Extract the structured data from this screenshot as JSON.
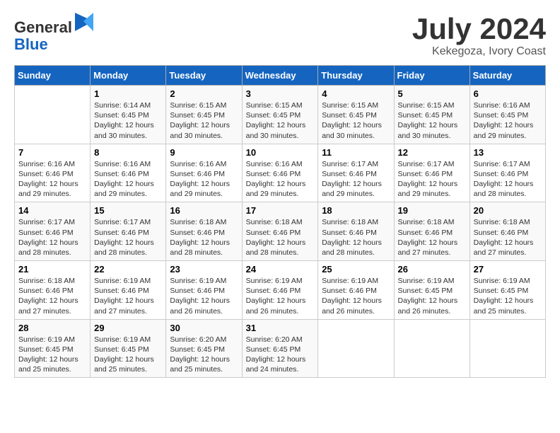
{
  "header": {
    "logo_line1": "General",
    "logo_line2": "Blue",
    "month": "July 2024",
    "location": "Kekegoza, Ivory Coast"
  },
  "days_of_week": [
    "Sunday",
    "Monday",
    "Tuesday",
    "Wednesday",
    "Thursday",
    "Friday",
    "Saturday"
  ],
  "weeks": [
    [
      {
        "day": "",
        "content": ""
      },
      {
        "day": "1",
        "content": "Sunrise: 6:14 AM\nSunset: 6:45 PM\nDaylight: 12 hours\nand 30 minutes."
      },
      {
        "day": "2",
        "content": "Sunrise: 6:15 AM\nSunset: 6:45 PM\nDaylight: 12 hours\nand 30 minutes."
      },
      {
        "day": "3",
        "content": "Sunrise: 6:15 AM\nSunset: 6:45 PM\nDaylight: 12 hours\nand 30 minutes."
      },
      {
        "day": "4",
        "content": "Sunrise: 6:15 AM\nSunset: 6:45 PM\nDaylight: 12 hours\nand 30 minutes."
      },
      {
        "day": "5",
        "content": "Sunrise: 6:15 AM\nSunset: 6:45 PM\nDaylight: 12 hours\nand 30 minutes."
      },
      {
        "day": "6",
        "content": "Sunrise: 6:16 AM\nSunset: 6:45 PM\nDaylight: 12 hours\nand 29 minutes."
      }
    ],
    [
      {
        "day": "7",
        "content": "Sunrise: 6:16 AM\nSunset: 6:46 PM\nDaylight: 12 hours\nand 29 minutes."
      },
      {
        "day": "8",
        "content": "Sunrise: 6:16 AM\nSunset: 6:46 PM\nDaylight: 12 hours\nand 29 minutes."
      },
      {
        "day": "9",
        "content": "Sunrise: 6:16 AM\nSunset: 6:46 PM\nDaylight: 12 hours\nand 29 minutes."
      },
      {
        "day": "10",
        "content": "Sunrise: 6:16 AM\nSunset: 6:46 PM\nDaylight: 12 hours\nand 29 minutes."
      },
      {
        "day": "11",
        "content": "Sunrise: 6:17 AM\nSunset: 6:46 PM\nDaylight: 12 hours\nand 29 minutes."
      },
      {
        "day": "12",
        "content": "Sunrise: 6:17 AM\nSunset: 6:46 PM\nDaylight: 12 hours\nand 29 minutes."
      },
      {
        "day": "13",
        "content": "Sunrise: 6:17 AM\nSunset: 6:46 PM\nDaylight: 12 hours\nand 28 minutes."
      }
    ],
    [
      {
        "day": "14",
        "content": "Sunrise: 6:17 AM\nSunset: 6:46 PM\nDaylight: 12 hours\nand 28 minutes."
      },
      {
        "day": "15",
        "content": "Sunrise: 6:17 AM\nSunset: 6:46 PM\nDaylight: 12 hours\nand 28 minutes."
      },
      {
        "day": "16",
        "content": "Sunrise: 6:18 AM\nSunset: 6:46 PM\nDaylight: 12 hours\nand 28 minutes."
      },
      {
        "day": "17",
        "content": "Sunrise: 6:18 AM\nSunset: 6:46 PM\nDaylight: 12 hours\nand 28 minutes."
      },
      {
        "day": "18",
        "content": "Sunrise: 6:18 AM\nSunset: 6:46 PM\nDaylight: 12 hours\nand 28 minutes."
      },
      {
        "day": "19",
        "content": "Sunrise: 6:18 AM\nSunset: 6:46 PM\nDaylight: 12 hours\nand 27 minutes."
      },
      {
        "day": "20",
        "content": "Sunrise: 6:18 AM\nSunset: 6:46 PM\nDaylight: 12 hours\nand 27 minutes."
      }
    ],
    [
      {
        "day": "21",
        "content": "Sunrise: 6:18 AM\nSunset: 6:46 PM\nDaylight: 12 hours\nand 27 minutes."
      },
      {
        "day": "22",
        "content": "Sunrise: 6:19 AM\nSunset: 6:46 PM\nDaylight: 12 hours\nand 27 minutes."
      },
      {
        "day": "23",
        "content": "Sunrise: 6:19 AM\nSunset: 6:46 PM\nDaylight: 12 hours\nand 26 minutes."
      },
      {
        "day": "24",
        "content": "Sunrise: 6:19 AM\nSunset: 6:46 PM\nDaylight: 12 hours\nand 26 minutes."
      },
      {
        "day": "25",
        "content": "Sunrise: 6:19 AM\nSunset: 6:46 PM\nDaylight: 12 hours\nand 26 minutes."
      },
      {
        "day": "26",
        "content": "Sunrise: 6:19 AM\nSunset: 6:45 PM\nDaylight: 12 hours\nand 26 minutes."
      },
      {
        "day": "27",
        "content": "Sunrise: 6:19 AM\nSunset: 6:45 PM\nDaylight: 12 hours\nand 25 minutes."
      }
    ],
    [
      {
        "day": "28",
        "content": "Sunrise: 6:19 AM\nSunset: 6:45 PM\nDaylight: 12 hours\nand 25 minutes."
      },
      {
        "day": "29",
        "content": "Sunrise: 6:19 AM\nSunset: 6:45 PM\nDaylight: 12 hours\nand 25 minutes."
      },
      {
        "day": "30",
        "content": "Sunrise: 6:20 AM\nSunset: 6:45 PM\nDaylight: 12 hours\nand 25 minutes."
      },
      {
        "day": "31",
        "content": "Sunrise: 6:20 AM\nSunset: 6:45 PM\nDaylight: 12 hours\nand 24 minutes."
      },
      {
        "day": "",
        "content": ""
      },
      {
        "day": "",
        "content": ""
      },
      {
        "day": "",
        "content": ""
      }
    ]
  ]
}
